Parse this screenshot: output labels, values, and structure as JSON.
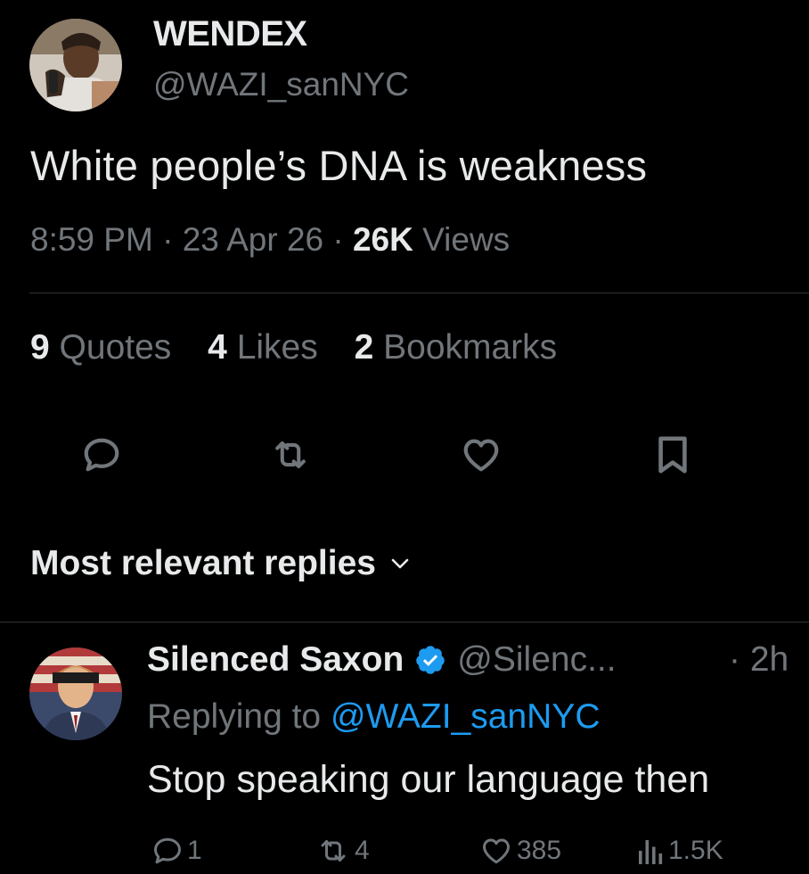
{
  "tweet": {
    "author_name": "WENDEX",
    "author_handle": "@WAZI_sanNYC",
    "text": "White people’s DNA is weakness",
    "time": "8:59 PM",
    "date": "23 Apr 26",
    "views_count": "26K",
    "views_label": "Views",
    "separator": "·"
  },
  "stats": {
    "quotes_count": "9",
    "quotes_label": "Quotes",
    "likes_count": "4",
    "likes_label": "Likes",
    "bookmarks_count": "2",
    "bookmarks_label": "Bookmarks"
  },
  "actions": [
    "reply-icon",
    "retweet-icon",
    "like-icon",
    "bookmark-icon"
  ],
  "replies_header": {
    "label": "Most relevant replies"
  },
  "reply": {
    "author_name": "Silenced Saxon",
    "author_handle": "@Silenc...",
    "time": "· 2h",
    "replying_prefix": "Replying to",
    "replying_mention": "@WAZI_sanNYC",
    "text": "Stop speaking our language then",
    "reply_count": "1",
    "retweet_count": "4",
    "like_count": "385",
    "view_count": "1.5K"
  },
  "colors": {
    "background": "#000000",
    "text_primary": "#e7e9ea",
    "text_secondary": "#71767b",
    "accent_blue": "#1d9bf0",
    "divider": "#2f3336"
  }
}
